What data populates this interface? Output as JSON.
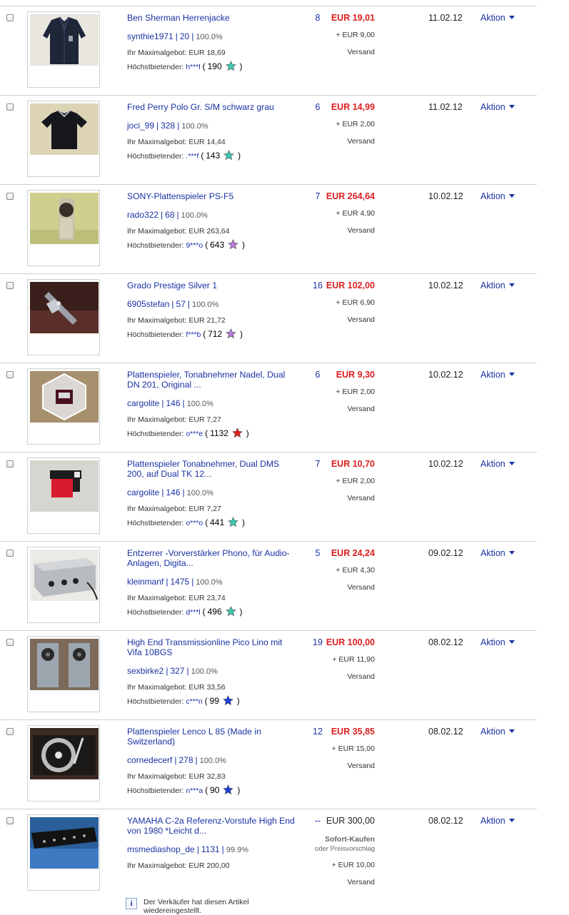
{
  "items": [
    {
      "title": "Ben Sherman Herrenjacke",
      "seller": "synthie1971",
      "seller_score": "20",
      "seller_pct": "100.0%",
      "max_label": "Ihr Maximalgebot:",
      "max_bid": "EUR 18,69",
      "hb_label": "Höchstbietender:",
      "hb_user": "h***l",
      "hb_open": "(",
      "hb_score": "190",
      "hb_close": ")",
      "star": "#3cc9b0",
      "bids": "8",
      "price": "EUR 19,01",
      "shipping": "+ EUR 9,00",
      "ship_label": "Versand",
      "date": "11.02.12",
      "action": "Aktion",
      "thumb": "jacket"
    },
    {
      "title": "Fred Perry Polo Gr. S/M schwarz grau",
      "seller": "joci_99",
      "seller_score": "328",
      "seller_pct": "100.0%",
      "max_label": "Ihr Maximalgebot:",
      "max_bid": "EUR 14,44",
      "hb_label": "Höchstbietender:",
      "hb_user": ".***f",
      "hb_open": "(",
      "hb_score": "143",
      "hb_close": ")",
      "star": "#3cc9b0",
      "bids": "6",
      "price": "EUR 14,99",
      "shipping": "+ EUR 2,00",
      "ship_label": "Versand",
      "date": "11.02.12",
      "action": "Aktion",
      "thumb": "polo"
    },
    {
      "title": "SONY-Plattenspieler PS-F5",
      "seller": "rado322",
      "seller_score": "68",
      "seller_pct": "100.0%",
      "max_label": "Ihr Maximalgebot:",
      "max_bid": "EUR 263,64",
      "hb_label": "Höchstbietender:",
      "hb_user": "9***o",
      "hb_open": "(",
      "hb_score": "643",
      "hb_close": ")",
      "star": "#b67ad6",
      "bids": "7",
      "price": "EUR 264,64",
      "shipping": "+ EUR 4,90",
      "ship_label": "Versand",
      "date": "10.02.12",
      "action": "Aktion",
      "thumb": "sony"
    },
    {
      "title": "Grado Prestige Silver 1",
      "seller": "6905stefan",
      "seller_score": "57",
      "seller_pct": "100.0%",
      "max_label": "Ihr Maximalgebot:",
      "max_bid": "EUR 21,72",
      "hb_label": "Höchstbietender:",
      "hb_user": "f***b",
      "hb_open": "(",
      "hb_score": "712",
      "hb_close": ")",
      "star": "#b67ad6",
      "bids": "16",
      "price": "EUR 102,00",
      "shipping": "+ EUR 6,90",
      "ship_label": "Versand",
      "date": "10.02.12",
      "action": "Aktion",
      "thumb": "grado"
    },
    {
      "title": "Plattenspieler, Tonabnehmer Nadel, Dual DN 201, Original ...",
      "seller": "cargolite",
      "seller_score": "146",
      "seller_pct": "100.0%",
      "max_label": "Ihr Maximalgebot:",
      "max_bid": "EUR 7,27",
      "hb_label": "Höchstbietender:",
      "hb_user": "o***e",
      "hb_open": "(",
      "hb_score": "1132",
      "hb_close": ")",
      "star": "#e0201e",
      "bids": "6",
      "price": "EUR 9,30",
      "shipping": "+ EUR 2,00",
      "ship_label": "Versand",
      "date": "10.02.12",
      "action": "Aktion",
      "thumb": "needle"
    },
    {
      "title": "Plattenspieler Tonabnehmer, Dual DMS 200, auf Dual TK 12...",
      "seller": "cargolite",
      "seller_score": "146",
      "seller_pct": "100.0%",
      "max_label": "Ihr Maximalgebot:",
      "max_bid": "EUR 7,27",
      "hb_label": "Höchstbietender:",
      "hb_user": "o***o",
      "hb_open": "(",
      "hb_score": "441",
      "hb_close": ")",
      "star": "#3cc9b0",
      "bids": "7",
      "price": "EUR 10,70",
      "shipping": "+ EUR 2,00",
      "ship_label": "Versand",
      "date": "10.02.12",
      "action": "Aktion",
      "thumb": "cartridge"
    },
    {
      "title": "Entzerrer -Vorverstärker Phono, für Audio-Anlagen, Digita...",
      "seller": "kleinmanf",
      "seller_score": "1475",
      "seller_pct": "100.0%",
      "max_label": "Ihr Maximalgebot:",
      "max_bid": "EUR 23,74",
      "hb_label": "Höchstbietender:",
      "hb_user": "d***l",
      "hb_open": "(",
      "hb_score": "496",
      "hb_close": ")",
      "star": "#3cc9b0",
      "bids": "5",
      "price": "EUR 24,24",
      "shipping": "+ EUR 4,30",
      "ship_label": "Versand",
      "date": "09.02.12",
      "action": "Aktion",
      "thumb": "preamp"
    },
    {
      "title": "High End Transmissionline Pico Lino mit Vifa 10BGS",
      "seller": "sexbirke2",
      "seller_score": "327",
      "seller_pct": "100.0%",
      "max_label": "Ihr Maximalgebot:",
      "max_bid": "EUR 33,56",
      "hb_label": "Höchstbietender:",
      "hb_user": "c***n",
      "hb_open": "(",
      "hb_score": "99",
      "hb_close": ")",
      "star": "#1f3fd8",
      "bids": "19",
      "price": "EUR 100,00",
      "shipping": "+ EUR 11,90",
      "ship_label": "Versand",
      "date": "08.02.12",
      "action": "Aktion",
      "thumb": "speakers"
    },
    {
      "title": "Plattenspieler Lenco L 85 (Made in Switzerland)",
      "seller": "cornedecerf",
      "seller_score": "278",
      "seller_pct": "100.0%",
      "max_label": "Ihr Maximalgebot:",
      "max_bid": "EUR 32,83",
      "hb_label": "Höchstbietender:",
      "hb_user": "n***a",
      "hb_open": "(",
      "hb_score": "90",
      "hb_close": ")",
      "star": "#1f3fd8",
      "bids": "12",
      "price": "EUR 35,85",
      "shipping": "+ EUR 15,00",
      "ship_label": "Versand",
      "date": "08.02.12",
      "action": "Aktion",
      "thumb": "lenco"
    },
    {
      "title": "YAMAHA C-2a Referenz-Vorstufe High End von 1980 *Leicht d...",
      "seller": "msmediashop_de",
      "seller_score": "1131",
      "seller_pct": "99.9%",
      "max_label": "Ihr Maximalgebot:",
      "max_bid": "EUR 200,00",
      "bids": "--",
      "price": "EUR 300,00",
      "buy_now": "Sofort-Kaufen",
      "buy_now_sub": "oder Preisvorschlag",
      "shipping": "+ EUR 10,00",
      "ship_label": "Versand",
      "date": "08.02.12",
      "action": "Aktion",
      "thumb": "yamaha"
    }
  ],
  "note": {
    "icon": "i",
    "text": "Der Verkäufer hat diesen Artikel wiedereingestellt."
  }
}
